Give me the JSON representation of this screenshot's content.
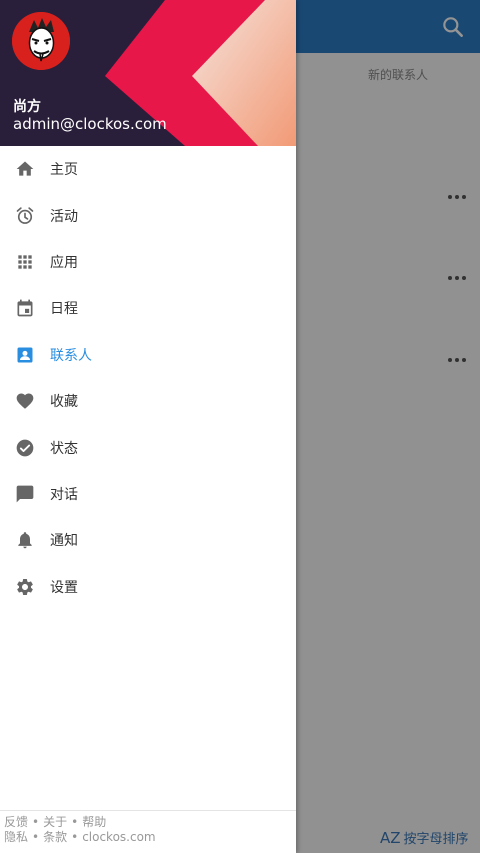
{
  "colors": {
    "appbar": "#2c7cc6",
    "active": "#2a8ee0",
    "icon": "#666666",
    "header_dark": "#2a1f3a",
    "header_red": "#e8174a",
    "header_peach": "#f4a585"
  },
  "user": {
    "name": "尚方",
    "email": "admin@clockos.com"
  },
  "content": {
    "new_contact": "新的联系人",
    "sort_label": "按字母排序",
    "sort_icon_text": "AZ"
  },
  "menu": [
    {
      "label": "主页",
      "icon": "home-icon"
    },
    {
      "label": "活动",
      "icon": "alarm-icon"
    },
    {
      "label": "应用",
      "icon": "apps-grid-icon"
    },
    {
      "label": "日程",
      "icon": "calendar-icon"
    },
    {
      "label": "联系人",
      "icon": "contact-icon",
      "active": true
    },
    {
      "label": "收藏",
      "icon": "heart-icon"
    },
    {
      "label": "状态",
      "icon": "check-circle-icon"
    },
    {
      "label": "对话",
      "icon": "chat-icon"
    },
    {
      "label": "通知",
      "icon": "bell-icon"
    },
    {
      "label": "设置",
      "icon": "gear-icon"
    }
  ],
  "footer": {
    "feedback": "反馈",
    "about": "关于",
    "help": "帮助",
    "privacy": "隐私",
    "terms": "条款",
    "site": "clockos.com",
    "separator": "•"
  }
}
